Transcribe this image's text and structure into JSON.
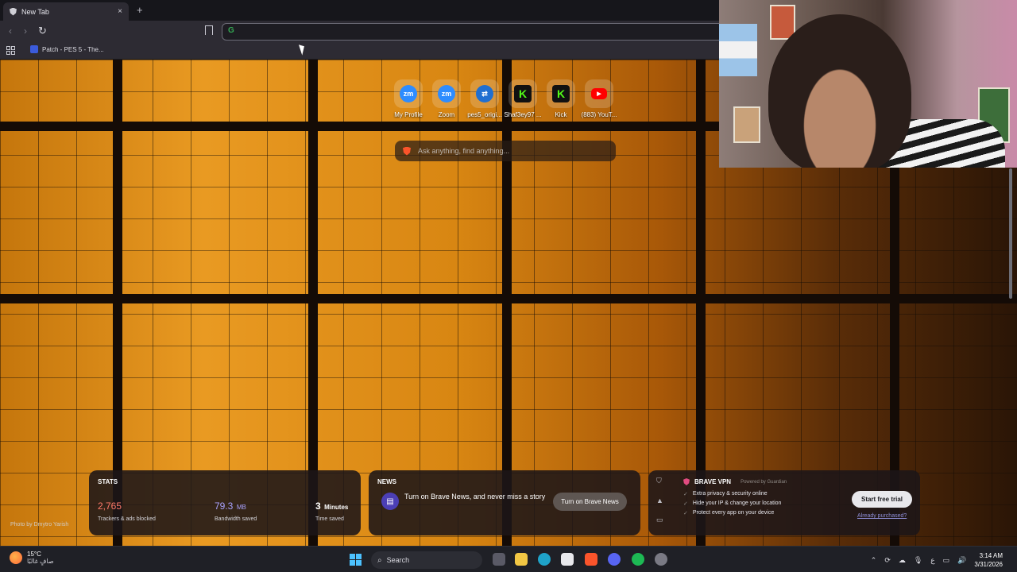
{
  "browser": {
    "tab_title": "New Tab",
    "tab_close": "×",
    "new_tab": "+",
    "back": "‹",
    "forward": "›",
    "reload": "↻",
    "url": "",
    "google_icon": "G",
    "bookmark_label": "Patch - PES 5 - The..."
  },
  "ntp": {
    "top_sites": [
      {
        "label": "My Profile",
        "glyph": "zm",
        "color": "#2d8cff"
      },
      {
        "label": "Zoom",
        "glyph": "zm",
        "color": "#2d8cff"
      },
      {
        "label": "pes5_origi...",
        "glyph": "⇄",
        "color": "#1f6fd1"
      },
      {
        "label": "Shaf3ey97 ...",
        "glyph": "K",
        "color": "#53fc18"
      },
      {
        "label": "Kick",
        "glyph": "K",
        "color": "#53fc18"
      },
      {
        "label": "(883) YouT...",
        "glyph": "▶",
        "color": "#ff0000"
      }
    ],
    "search_placeholder": "Ask anything, find anything...",
    "photo_credit": "Photo by Dmytro Yarish"
  },
  "stats": {
    "title": "STATS",
    "trackers": {
      "value": "2,765",
      "caption": "Trackers & ads blocked",
      "color": "#ff7a6a"
    },
    "bandwidth": {
      "value": "79.3",
      "unit": "MB",
      "caption": "Bandwidth saved",
      "color": "#a9a2ff"
    },
    "time": {
      "value": "3",
      "unit": "Minutes",
      "caption": "Time saved"
    }
  },
  "news": {
    "title": "NEWS",
    "text": "Turn on Brave News, and never miss a story",
    "button": "Turn on Brave News"
  },
  "vpn": {
    "title": "BRAVE VPN",
    "powered": "Powered by Guardian",
    "features": [
      "Extra privacy & security online",
      "Hide your IP & change your location",
      "Protect every app on your device"
    ],
    "button": "Start free trial",
    "link": "Already purchased?"
  },
  "taskbar": {
    "temp": "15°C",
    "weather_desc": "صافٍ غالبًا",
    "search": "Search",
    "lang": "ع",
    "time": "3:14 AM",
    "date": "3/31/2026"
  }
}
